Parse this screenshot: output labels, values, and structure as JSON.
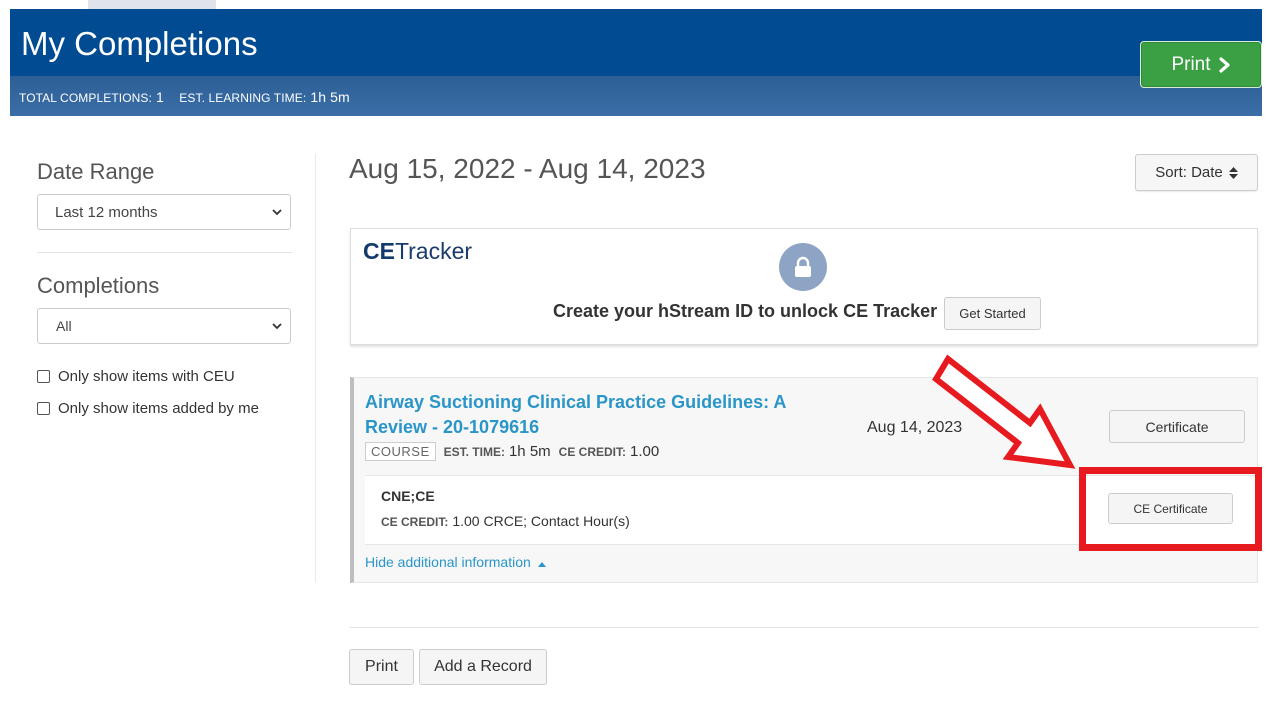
{
  "header": {
    "title": "My Completions",
    "total_label": "TOTAL COMPLETIONS:",
    "total_value": "1",
    "time_label": "EST. LEARNING TIME:",
    "time_value": "1h 5m",
    "print_label": "Print"
  },
  "sidebar": {
    "date_range_label": "Date Range",
    "date_range_value": "Last 12 months",
    "completions_label": "Completions",
    "completions_value": "All",
    "checkbox_ceu": "Only show items with CEU",
    "checkbox_added": "Only show items added by me"
  },
  "main": {
    "date_range": "Aug 15, 2022 - Aug 14, 2023",
    "sort_label": "Sort: Date"
  },
  "ce_tracker": {
    "logo_bold": "CE",
    "logo_rest": "Tracker",
    "message": "Create your hStream ID to unlock CE Tracker",
    "button": "Get Started"
  },
  "course": {
    "title": "Airway Suctioning Clinical Practice Guidelines: A Review - 20-1079616",
    "type_tag": "COURSE",
    "est_time_label": "EST. TIME:",
    "est_time_value": "1h 5m",
    "credit_label": "CE CREDIT:",
    "credit_value": "1.00",
    "date": "Aug 14, 2023",
    "certificate_button": "Certificate",
    "detail_heading": "CNE;CE",
    "detail_credit_label": "CE CREDIT:",
    "detail_credit_value": "1.00 CRCE; Contact Hour(s)",
    "ce_certificate_button": "CE Certificate",
    "hide_link": "Hide additional information"
  },
  "footer": {
    "print_button": "Print",
    "add_record_button": "Add a Record"
  },
  "colors": {
    "header_blue": "#004b91",
    "print_green": "#3aa043",
    "link_blue": "#2a95c8",
    "annotation_red": "#e61a1f"
  }
}
